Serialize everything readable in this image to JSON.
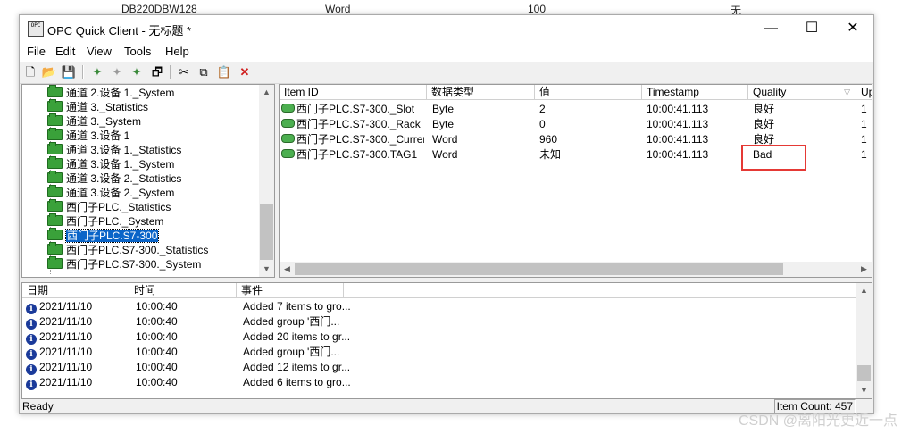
{
  "background_row": [
    "DB220DBW128",
    "Word",
    "100",
    "无"
  ],
  "window": {
    "app_icon_text": "OPC",
    "title": "OPC Quick Client - 无标题 *",
    "controls": {
      "minimize": "—",
      "maximize": "☐",
      "close": "✕"
    }
  },
  "menu": [
    "File",
    "Edit",
    "View",
    "Tools",
    "Help"
  ],
  "toolbar": [
    {
      "name": "new-icon",
      "glyph": "🗋"
    },
    {
      "name": "open-icon",
      "glyph": "📂"
    },
    {
      "name": "save-icon",
      "glyph": "💾"
    },
    {
      "name": "new-server-icon",
      "glyph": "✦"
    },
    {
      "name": "new-group-icon",
      "glyph": "✦"
    },
    {
      "name": "new-item-icon",
      "glyph": "✦"
    },
    {
      "name": "properties-icon",
      "glyph": "🗗"
    },
    {
      "name": "cut-icon",
      "glyph": "✂"
    },
    {
      "name": "copy-icon",
      "glyph": "⧉"
    },
    {
      "name": "paste-icon",
      "glyph": "📋"
    },
    {
      "name": "delete-icon",
      "glyph": "✕"
    }
  ],
  "tree": {
    "items": [
      {
        "label": "通道 2.设备 1._System",
        "selected": false
      },
      {
        "label": "通道 3._Statistics",
        "selected": false
      },
      {
        "label": "通道 3._System",
        "selected": false
      },
      {
        "label": "通道 3.设备 1",
        "selected": false
      },
      {
        "label": "通道 3.设备 1._Statistics",
        "selected": false
      },
      {
        "label": "通道 3.设备 1._System",
        "selected": false
      },
      {
        "label": "通道 3.设备 2._Statistics",
        "selected": false
      },
      {
        "label": "通道 3.设备 2._System",
        "selected": false
      },
      {
        "label": "西门子PLC._Statistics",
        "selected": false
      },
      {
        "label": "西门子PLC._System",
        "selected": false
      },
      {
        "label": "西门子PLC.S7-300",
        "selected": true
      },
      {
        "label": "西门子PLC.S7-300._Statistics",
        "selected": false
      },
      {
        "label": "西门子PLC.S7-300._System",
        "selected": false
      }
    ]
  },
  "items_table": {
    "columns": [
      "Item ID",
      "数据类型",
      "值",
      "Timestamp",
      "Quality",
      "Up"
    ],
    "rows": [
      {
        "id": "西门子PLC.S7-300._Slot",
        "type": "Byte",
        "value": "2",
        "timestamp": "10:00:41.113",
        "quality": "良好",
        "up": "1"
      },
      {
        "id": "西门子PLC.S7-300._Rack",
        "type": "Byte",
        "value": "0",
        "timestamp": "10:00:41.113",
        "quality": "良好",
        "up": "1"
      },
      {
        "id": "西门子PLC.S7-300._Current...",
        "type": "Word",
        "value": "960",
        "timestamp": "10:00:41.113",
        "quality": "良好",
        "up": "1"
      },
      {
        "id": "西门子PLC.S7-300.TAG1",
        "type": "Word",
        "value": "未知",
        "timestamp": "10:00:41.113",
        "quality": "Bad",
        "up": "1"
      }
    ]
  },
  "log": {
    "columns": [
      "日期",
      "时间",
      "事件"
    ],
    "rows": [
      {
        "date": "2021/11/10",
        "time": "10:00:40",
        "event": "Added 7 items to gro..."
      },
      {
        "date": "2021/11/10",
        "time": "10:00:40",
        "event": "Added group '西门..."
      },
      {
        "date": "2021/11/10",
        "time": "10:00:40",
        "event": "Added 20 items to gr..."
      },
      {
        "date": "2021/11/10",
        "time": "10:00:40",
        "event": "Added group '西门..."
      },
      {
        "date": "2021/11/10",
        "time": "10:00:40",
        "event": "Added 12 items to gr..."
      },
      {
        "date": "2021/11/10",
        "time": "10:00:40",
        "event": "Added 6 items to gro..."
      }
    ]
  },
  "status": {
    "text": "Ready",
    "item_count": "Item Count: 457"
  },
  "watermark": "CSDN @离阳光更近一点",
  "colors": {
    "selection": "#0a64c8",
    "highlight_box": "#e53935",
    "folder_green": "#3aa13a"
  }
}
